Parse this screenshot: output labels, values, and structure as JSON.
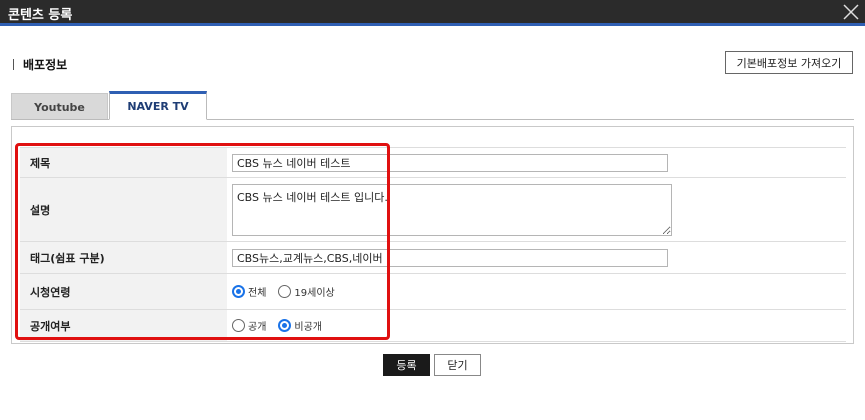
{
  "window": {
    "title": "콘텐츠 등록",
    "close_icon": "close-icon"
  },
  "section": {
    "title": "배포정보",
    "load_button": "기본배포정보 가져오기"
  },
  "tabs": [
    {
      "label": "Youtube",
      "active": false
    },
    {
      "label": "NAVER TV",
      "active": true
    }
  ],
  "form": {
    "title_label": "제목",
    "title_value": "CBS 뉴스 네이버 테스트",
    "desc_label": "설명",
    "desc_value": "CBS 뉴스 네이버 테스트 입니다.",
    "tags_label": "태그(쉼표 구분)",
    "tags_value": "CBS뉴스,교계뉴스,CBS,네이버",
    "age_label": "시청연령",
    "age_options": [
      {
        "label": "전체",
        "checked": true
      },
      {
        "label": "19세이상",
        "checked": false
      }
    ],
    "visibility_label": "공개여부",
    "visibility_options": [
      {
        "label": "공개",
        "checked": false
      },
      {
        "label": "비공개",
        "checked": true
      }
    ]
  },
  "footer": {
    "submit_label": "등록",
    "close_label": "닫기"
  },
  "colors": {
    "accent": "#2f5fb3",
    "highlight": "#e01010",
    "radio": "#1a73e8"
  }
}
